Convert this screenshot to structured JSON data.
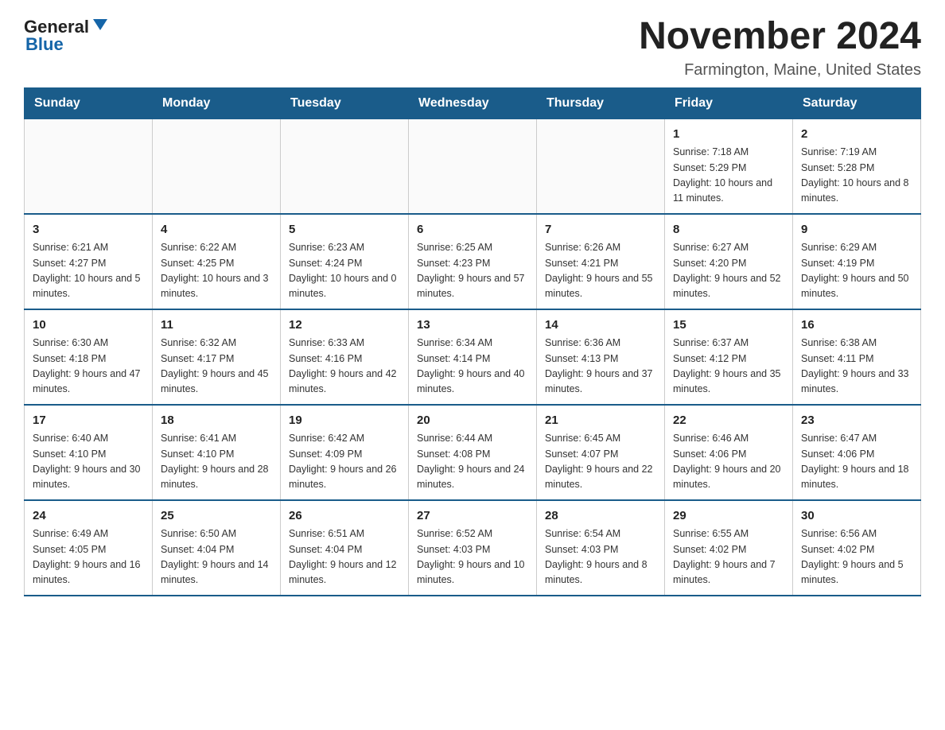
{
  "header": {
    "logo_general": "General",
    "logo_blue": "Blue",
    "title": "November 2024",
    "subtitle": "Farmington, Maine, United States"
  },
  "weekdays": [
    "Sunday",
    "Monday",
    "Tuesday",
    "Wednesday",
    "Thursday",
    "Friday",
    "Saturday"
  ],
  "weeks": [
    [
      {
        "day": "",
        "info": ""
      },
      {
        "day": "",
        "info": ""
      },
      {
        "day": "",
        "info": ""
      },
      {
        "day": "",
        "info": ""
      },
      {
        "day": "",
        "info": ""
      },
      {
        "day": "1",
        "info": "Sunrise: 7:18 AM\nSunset: 5:29 PM\nDaylight: 10 hours\nand 11 minutes."
      },
      {
        "day": "2",
        "info": "Sunrise: 7:19 AM\nSunset: 5:28 PM\nDaylight: 10 hours\nand 8 minutes."
      }
    ],
    [
      {
        "day": "3",
        "info": "Sunrise: 6:21 AM\nSunset: 4:27 PM\nDaylight: 10 hours\nand 5 minutes."
      },
      {
        "day": "4",
        "info": "Sunrise: 6:22 AM\nSunset: 4:25 PM\nDaylight: 10 hours\nand 3 minutes."
      },
      {
        "day": "5",
        "info": "Sunrise: 6:23 AM\nSunset: 4:24 PM\nDaylight: 10 hours\nand 0 minutes."
      },
      {
        "day": "6",
        "info": "Sunrise: 6:25 AM\nSunset: 4:23 PM\nDaylight: 9 hours\nand 57 minutes."
      },
      {
        "day": "7",
        "info": "Sunrise: 6:26 AM\nSunset: 4:21 PM\nDaylight: 9 hours\nand 55 minutes."
      },
      {
        "day": "8",
        "info": "Sunrise: 6:27 AM\nSunset: 4:20 PM\nDaylight: 9 hours\nand 52 minutes."
      },
      {
        "day": "9",
        "info": "Sunrise: 6:29 AM\nSunset: 4:19 PM\nDaylight: 9 hours\nand 50 minutes."
      }
    ],
    [
      {
        "day": "10",
        "info": "Sunrise: 6:30 AM\nSunset: 4:18 PM\nDaylight: 9 hours\nand 47 minutes."
      },
      {
        "day": "11",
        "info": "Sunrise: 6:32 AM\nSunset: 4:17 PM\nDaylight: 9 hours\nand 45 minutes."
      },
      {
        "day": "12",
        "info": "Sunrise: 6:33 AM\nSunset: 4:16 PM\nDaylight: 9 hours\nand 42 minutes."
      },
      {
        "day": "13",
        "info": "Sunrise: 6:34 AM\nSunset: 4:14 PM\nDaylight: 9 hours\nand 40 minutes."
      },
      {
        "day": "14",
        "info": "Sunrise: 6:36 AM\nSunset: 4:13 PM\nDaylight: 9 hours\nand 37 minutes."
      },
      {
        "day": "15",
        "info": "Sunrise: 6:37 AM\nSunset: 4:12 PM\nDaylight: 9 hours\nand 35 minutes."
      },
      {
        "day": "16",
        "info": "Sunrise: 6:38 AM\nSunset: 4:11 PM\nDaylight: 9 hours\nand 33 minutes."
      }
    ],
    [
      {
        "day": "17",
        "info": "Sunrise: 6:40 AM\nSunset: 4:10 PM\nDaylight: 9 hours\nand 30 minutes."
      },
      {
        "day": "18",
        "info": "Sunrise: 6:41 AM\nSunset: 4:10 PM\nDaylight: 9 hours\nand 28 minutes."
      },
      {
        "day": "19",
        "info": "Sunrise: 6:42 AM\nSunset: 4:09 PM\nDaylight: 9 hours\nand 26 minutes."
      },
      {
        "day": "20",
        "info": "Sunrise: 6:44 AM\nSunset: 4:08 PM\nDaylight: 9 hours\nand 24 minutes."
      },
      {
        "day": "21",
        "info": "Sunrise: 6:45 AM\nSunset: 4:07 PM\nDaylight: 9 hours\nand 22 minutes."
      },
      {
        "day": "22",
        "info": "Sunrise: 6:46 AM\nSunset: 4:06 PM\nDaylight: 9 hours\nand 20 minutes."
      },
      {
        "day": "23",
        "info": "Sunrise: 6:47 AM\nSunset: 4:06 PM\nDaylight: 9 hours\nand 18 minutes."
      }
    ],
    [
      {
        "day": "24",
        "info": "Sunrise: 6:49 AM\nSunset: 4:05 PM\nDaylight: 9 hours\nand 16 minutes."
      },
      {
        "day": "25",
        "info": "Sunrise: 6:50 AM\nSunset: 4:04 PM\nDaylight: 9 hours\nand 14 minutes."
      },
      {
        "day": "26",
        "info": "Sunrise: 6:51 AM\nSunset: 4:04 PM\nDaylight: 9 hours\nand 12 minutes."
      },
      {
        "day": "27",
        "info": "Sunrise: 6:52 AM\nSunset: 4:03 PM\nDaylight: 9 hours\nand 10 minutes."
      },
      {
        "day": "28",
        "info": "Sunrise: 6:54 AM\nSunset: 4:03 PM\nDaylight: 9 hours\nand 8 minutes."
      },
      {
        "day": "29",
        "info": "Sunrise: 6:55 AM\nSunset: 4:02 PM\nDaylight: 9 hours\nand 7 minutes."
      },
      {
        "day": "30",
        "info": "Sunrise: 6:56 AM\nSunset: 4:02 PM\nDaylight: 9 hours\nand 5 minutes."
      }
    ]
  ]
}
